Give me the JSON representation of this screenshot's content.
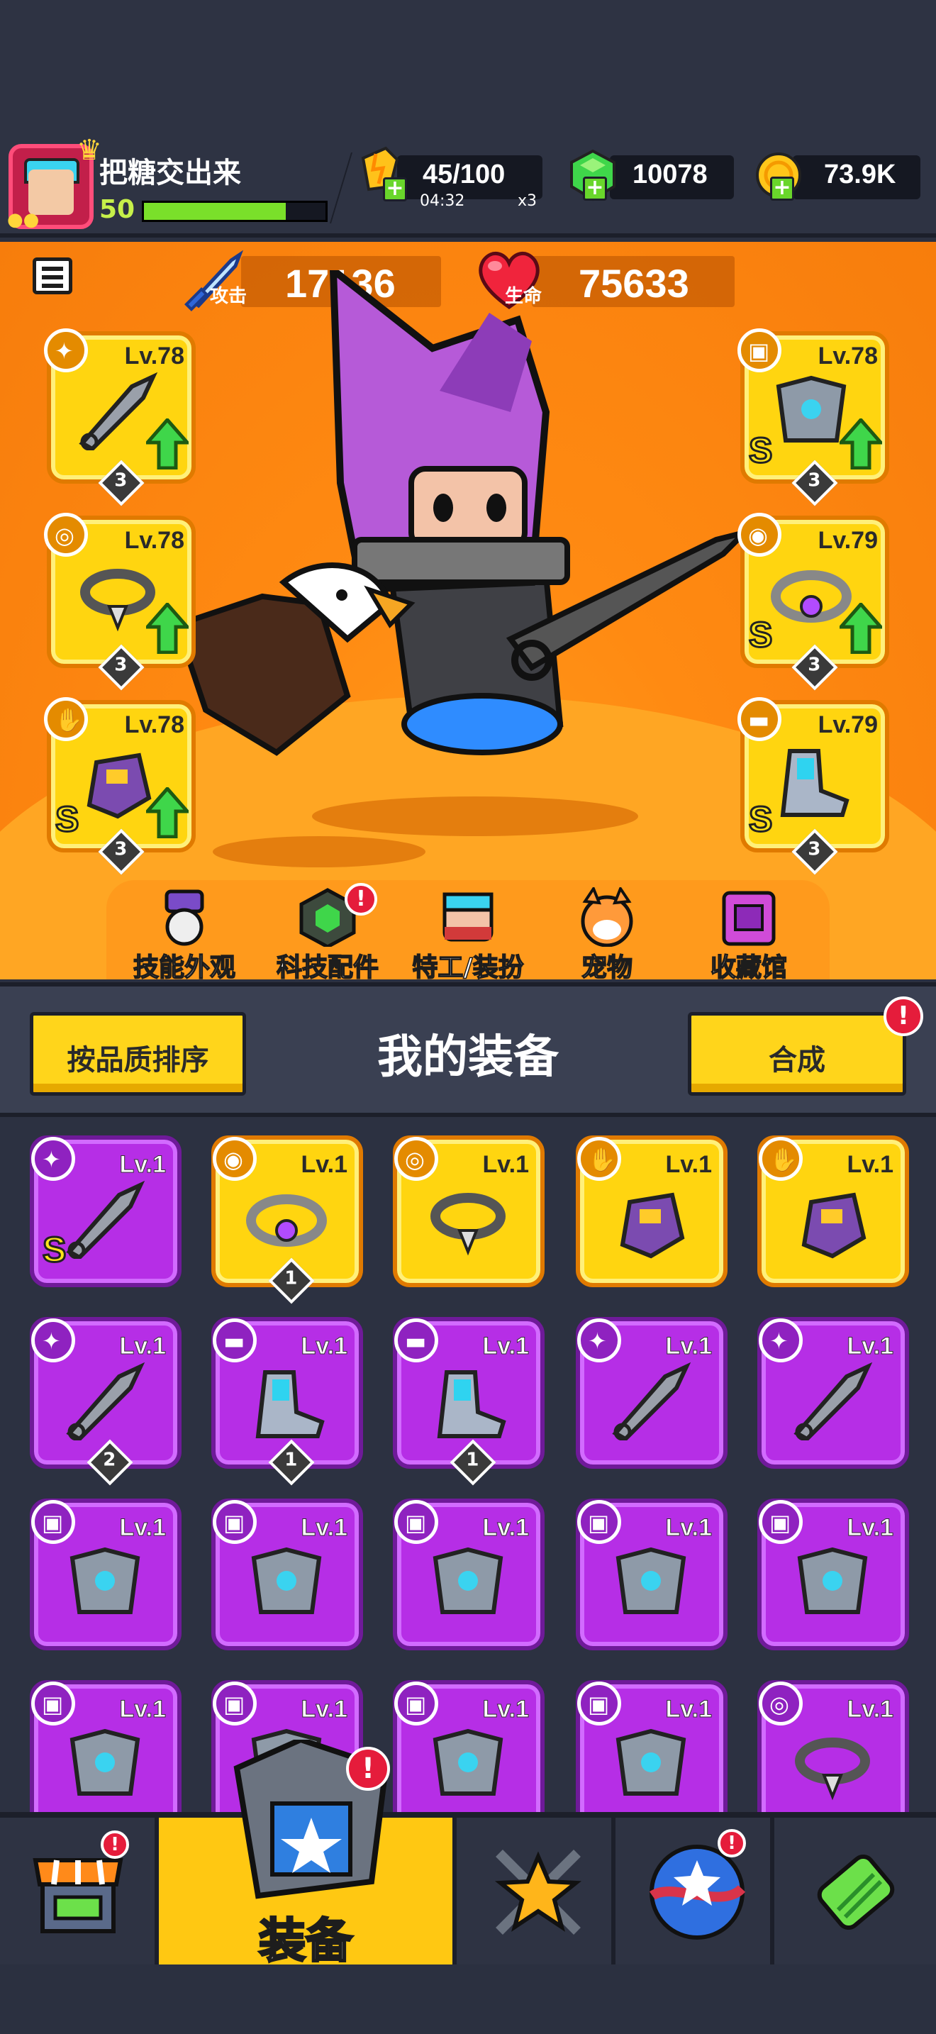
{
  "player": {
    "name": "把糖交出来",
    "level": "50",
    "xp_fraction": 0.78
  },
  "resources": {
    "energy": "45/100",
    "energy_timer": "04:32",
    "energy_multiplier": "x3",
    "gems": "10078",
    "coins": "73.9K"
  },
  "stats": {
    "attack_value": "17136",
    "attack_label": "攻击",
    "hp_value": "75633",
    "hp_label": "生命"
  },
  "equipped": [
    {
      "slot": "weapon",
      "level": "Lv.78",
      "count": "3",
      "rank": "",
      "upgrade": true
    },
    {
      "slot": "necklace",
      "level": "Lv.78",
      "count": "3",
      "rank": "",
      "upgrade": true
    },
    {
      "slot": "gloves",
      "level": "Lv.78",
      "count": "3",
      "rank": "S",
      "upgrade": true
    },
    {
      "slot": "armor",
      "level": "Lv.78",
      "count": "3",
      "rank": "S",
      "upgrade": true
    },
    {
      "slot": "belt",
      "level": "Lv.79",
      "count": "3",
      "rank": "S",
      "upgrade": true
    },
    {
      "slot": "boots",
      "level": "Lv.79",
      "count": "3",
      "rank": "S",
      "upgrade": false
    }
  ],
  "shortcuts": [
    {
      "label": "技能外观",
      "icon": "skill-skin-icon",
      "alert": false
    },
    {
      "label": "科技配件",
      "icon": "tech-parts-icon",
      "alert": true
    },
    {
      "label": "特工/装扮",
      "icon": "agent-costume-icon",
      "alert": false
    },
    {
      "label": "宠物",
      "icon": "pet-icon",
      "alert": false
    },
    {
      "label": "收藏馆",
      "icon": "collection-icon",
      "alert": false
    }
  ],
  "equipment_panel": {
    "sort_label": "按品质排序",
    "title": "我的装备",
    "merge_label": "合成",
    "merge_alert": "!"
  },
  "inventory": [
    {
      "type": "weapon",
      "level": "Lv.1",
      "color": "purple",
      "count": "",
      "rank": "S"
    },
    {
      "type": "belt",
      "level": "Lv.1",
      "color": "yellow",
      "count": "1",
      "rank": ""
    },
    {
      "type": "necklace",
      "level": "Lv.1",
      "color": "yellow",
      "count": "",
      "rank": ""
    },
    {
      "type": "gloves",
      "level": "Lv.1",
      "color": "yellow",
      "count": "",
      "rank": ""
    },
    {
      "type": "gloves",
      "level": "Lv.1",
      "color": "yellow",
      "count": "",
      "rank": ""
    },
    {
      "type": "weapon",
      "level": "Lv.1",
      "color": "purple",
      "count": "2",
      "rank": ""
    },
    {
      "type": "boots",
      "level": "Lv.1",
      "color": "purple",
      "count": "1",
      "rank": ""
    },
    {
      "type": "boots",
      "level": "Lv.1",
      "color": "purple",
      "count": "1",
      "rank": ""
    },
    {
      "type": "weapon",
      "level": "Lv.1",
      "color": "purple",
      "count": "",
      "rank": ""
    },
    {
      "type": "weapon",
      "level": "Lv.1",
      "color": "purple",
      "count": "",
      "rank": ""
    },
    {
      "type": "armor",
      "level": "Lv.1",
      "color": "purple",
      "count": "",
      "rank": ""
    },
    {
      "type": "armor",
      "level": "Lv.1",
      "color": "purple",
      "count": "",
      "rank": ""
    },
    {
      "type": "armor",
      "level": "Lv.1",
      "color": "purple",
      "count": "",
      "rank": ""
    },
    {
      "type": "armor",
      "level": "Lv.1",
      "color": "purple",
      "count": "",
      "rank": ""
    },
    {
      "type": "armor",
      "level": "Lv.1",
      "color": "purple",
      "count": "",
      "rank": ""
    },
    {
      "type": "armor",
      "level": "Lv.1",
      "color": "purple",
      "count": "",
      "rank": ""
    },
    {
      "type": "armor",
      "level": "Lv.1",
      "color": "purple",
      "count": "",
      "rank": ""
    },
    {
      "type": "armor",
      "level": "Lv.1",
      "color": "purple",
      "count": "",
      "rank": ""
    },
    {
      "type": "armor",
      "level": "Lv.1",
      "color": "purple",
      "count": "",
      "rank": ""
    },
    {
      "type": "necklace",
      "level": "Lv.1",
      "color": "purple",
      "count": "",
      "rank": ""
    }
  ],
  "nav": {
    "shop_alert": "!",
    "equip_label": "装备",
    "equip_alert": "!",
    "events_alert": "!"
  },
  "colors": {
    "hero_bg": "#ff8a12",
    "legendary": "#ffd510",
    "epic": "#b62ee6",
    "alert": "#e51c3b"
  }
}
